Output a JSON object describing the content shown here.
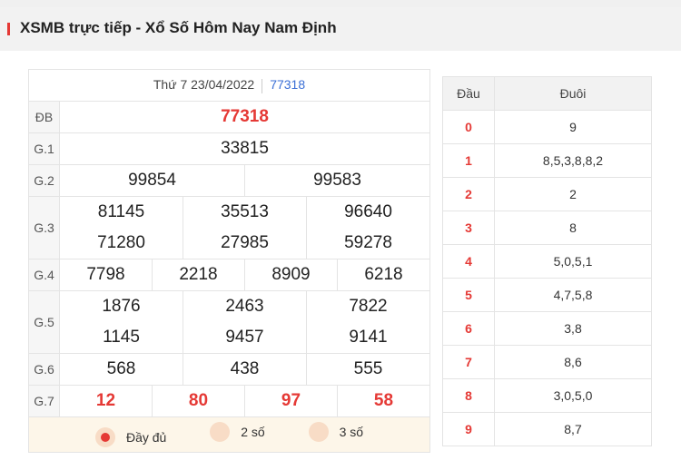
{
  "header": {
    "title": "XSMB trực tiếp - Xổ Số Hôm Nay Nam Định"
  },
  "results": {
    "date": "Thứ 7 23/04/2022",
    "code": "77318",
    "labels": [
      "ĐB",
      "G.1",
      "G.2",
      "G.3",
      "G.4",
      "G.5",
      "G.6",
      "G.7"
    ],
    "db": "77318",
    "g1": "33815",
    "g2": [
      "99854",
      "99583"
    ],
    "g3": [
      "81145",
      "35513",
      "96640",
      "71280",
      "27985",
      "59278"
    ],
    "g4": [
      "7798",
      "2218",
      "8909",
      "6218"
    ],
    "g5": [
      "1876",
      "2463",
      "7822",
      "1145",
      "9457",
      "9141"
    ],
    "g6": [
      "568",
      "438",
      "555"
    ],
    "g7": [
      "12",
      "80",
      "97",
      "58"
    ]
  },
  "options": [
    {
      "label": "Đầy đủ",
      "selected": true
    },
    {
      "label": "2 số",
      "selected": false
    },
    {
      "label": "3 số",
      "selected": false
    }
  ],
  "loto": {
    "col_head": "Đầu",
    "col_tail": "Đuôi",
    "rows": [
      {
        "head": "0",
        "tail": "9"
      },
      {
        "head": "1",
        "tail": "8,5,3,8,8,2"
      },
      {
        "head": "2",
        "tail": "2"
      },
      {
        "head": "3",
        "tail": "8"
      },
      {
        "head": "4",
        "tail": "5,0,5,1"
      },
      {
        "head": "5",
        "tail": "4,7,5,8"
      },
      {
        "head": "6",
        "tail": "3,8"
      },
      {
        "head": "7",
        "tail": "8,6"
      },
      {
        "head": "8",
        "tail": "3,0,5,0"
      },
      {
        "head": "9",
        "tail": "8,7"
      }
    ]
  },
  "colors": {
    "accent": "#e53935",
    "link": "#3b6fd6",
    "option_bg": "#fdf6e9"
  }
}
